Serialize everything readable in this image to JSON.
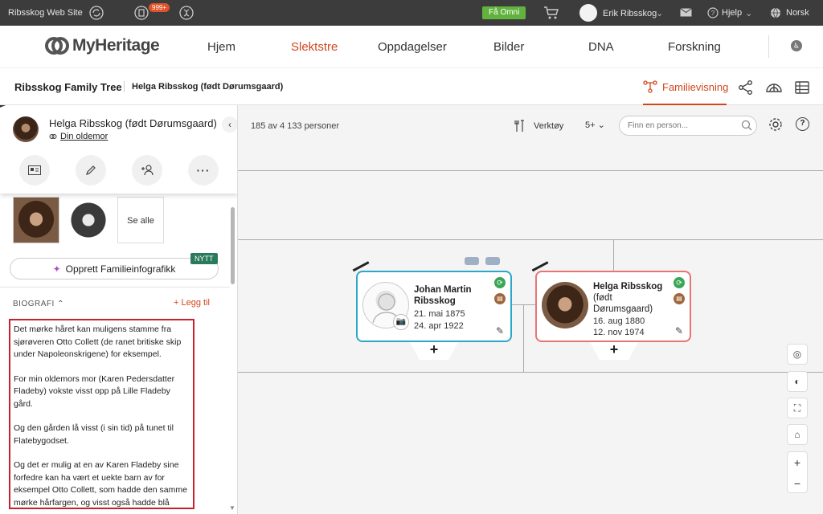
{
  "topbar": {
    "site_label": "Ribsskog Web Site",
    "badge_count": "999+",
    "omni_label": "Få Omni",
    "user_name": "Erik Ribsskog",
    "help_label": "Hjelp",
    "language": "Norsk"
  },
  "nav": {
    "logo": "MyHeritage",
    "items": [
      "Hjem",
      "Slektstre",
      "Oppdagelser",
      "Bilder",
      "DNA",
      "Forskning"
    ],
    "active_index": 1
  },
  "treebar": {
    "tree_name": "Ribsskog Family Tree",
    "person": "Helga Ribsskog (født Dørumsgaard)",
    "view_label": "Familievisning"
  },
  "panel": {
    "person_name": "Helga Ribsskog (født Dørumsgaard)",
    "relation": "Din oldemor",
    "see_all": "Se alle",
    "infographic": "Opprett Familieinfografikk",
    "new_badge": "NYTT",
    "bio_heading": "BIOGRAFI",
    "add_label": "+ Legg til",
    "bio_paragraphs": [
      "Det mørke håret kan muligens stamme fra sjørøveren Otto Collett (de ranet britiske skip under Napoleonskrigene) for eksempel.",
      "For min oldemors mor (Karen Pedersdatter Fladeby) vokste visst opp på Lille Fladeby gård.",
      "Og den gården lå visst (i sin tid) på tunet til Flatebygodset.",
      "Og det er mulig at en av Karen Fladeby sine forfedre kan ha vært et uekte barn av for eksempel Otto Collett, som hadde den samme mørke hårfargen, og visst også hadde blå øyne (som min mor og hennes søsken)."
    ]
  },
  "toolbar": {
    "count": "185 av 4 133 personer",
    "tools": "Verktøy",
    "generations": "5+",
    "search_placeholder": "Finn en person..."
  },
  "tree": {
    "male": {
      "name": "Johan Martin Ribsskog",
      "birth": "21. mai 1875",
      "death": "24. apr 1922"
    },
    "female": {
      "name": "Helga Ribsskog",
      "maiden": "(født Dørumsgaard)",
      "birth": "16. aug 1880",
      "death": "12. nov 1974"
    }
  },
  "colors": {
    "accent": "#d0471c",
    "male_border": "#2ba8c8",
    "female_border": "#e77574",
    "highlight_box": "#c8202e"
  }
}
